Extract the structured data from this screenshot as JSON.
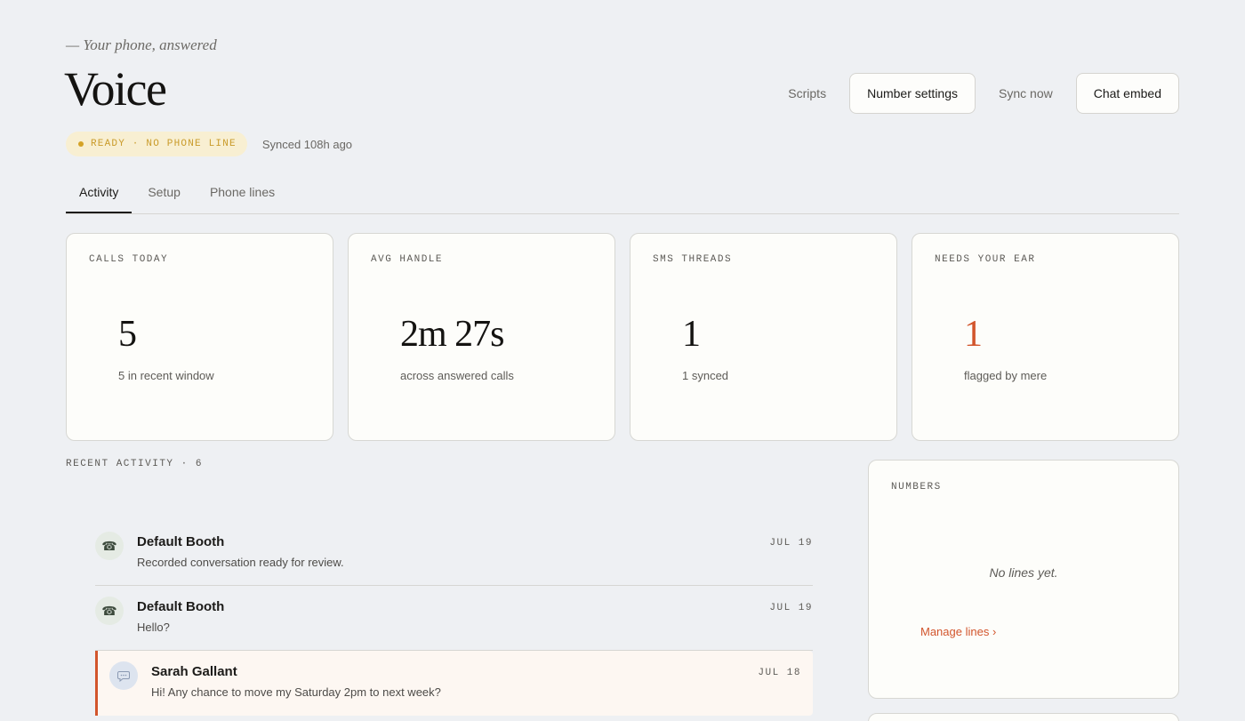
{
  "header": {
    "tagline": "— Your phone, answered",
    "title": "Voice",
    "actions": {
      "scripts": "Scripts",
      "number_settings": "Number settings",
      "sync_now": "Sync now",
      "chat_embed": "Chat embed"
    },
    "status_badge": "READY · NO PHONE LINE",
    "synced": "Synced 108h ago"
  },
  "tabs": [
    {
      "label": "Activity",
      "active": true
    },
    {
      "label": "Setup",
      "active": false
    },
    {
      "label": "Phone lines",
      "active": false
    }
  ],
  "stats": [
    {
      "label": "CALLS TODAY",
      "value": "5",
      "sub": "5 in recent window"
    },
    {
      "label": "AVG HANDLE",
      "value": "2m 27s",
      "sub": "across answered calls"
    },
    {
      "label": "SMS THREADS",
      "value": "1",
      "sub": "1 synced"
    },
    {
      "label": "NEEDS YOUR EAR",
      "value": "1",
      "sub": "flagged by mere"
    }
  ],
  "recent": {
    "label": "RECENT ACTIVITY · 6",
    "items": [
      {
        "icon": "phone-icon",
        "name": "Default Booth",
        "text": "Recorded conversation ready for review.",
        "date": "JUL 19"
      },
      {
        "icon": "phone-icon",
        "name": "Default Booth",
        "text": "Hello?",
        "date": "JUL 19"
      },
      {
        "icon": "chat-bubble-icon",
        "name": "Sarah Gallant",
        "text": "Hi! Any chance to move my Saturday 2pm to next week?",
        "date": "JUL 18"
      }
    ]
  },
  "numbers": {
    "label": "NUMBERS",
    "empty": "No lines yet.",
    "manage": "Manage lines ›"
  },
  "colors": {
    "accent": "#d2552c",
    "badge_text": "#c99b2a",
    "badge_bg": "#f8efd2",
    "background": "#eef0f3",
    "card": "#fdfdfa"
  }
}
